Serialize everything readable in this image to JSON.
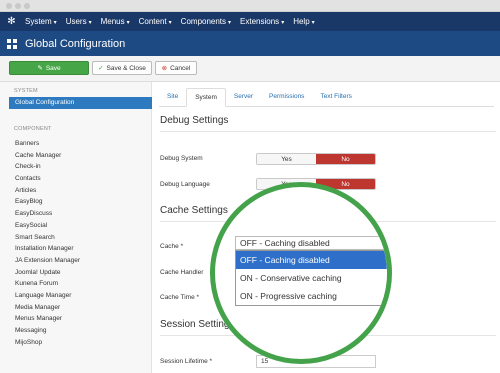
{
  "menubar": {
    "items": [
      {
        "label": "System"
      },
      {
        "label": "Users"
      },
      {
        "label": "Menus"
      },
      {
        "label": "Content"
      },
      {
        "label": "Components"
      },
      {
        "label": "Extensions"
      },
      {
        "label": "Help"
      }
    ],
    "caret": "▾"
  },
  "header": {
    "title": "Global Configuration"
  },
  "toolbar": {
    "save_label": "Save",
    "save_close_label": "Save & Close",
    "cancel_label": "Cancel"
  },
  "sidebar": {
    "system_heading": "SYSTEM",
    "active_item": "Global Configuration",
    "component_heading": "COMPONENT",
    "items": [
      "Banners",
      "Cache Manager",
      "Check-in",
      "Contacts",
      "Articles",
      "EasyBlog",
      "EasyDiscuss",
      "EasySocial",
      "Smart Search",
      "Installation Manager",
      "JA Extension Manager",
      "Joomla! Update",
      "Kunena Forum",
      "Language Manager",
      "Media Manager",
      "Menus Manager",
      "Messaging",
      "MijoShop"
    ]
  },
  "tabs": [
    "Site",
    "System",
    "Server",
    "Permissions",
    "Text Filters"
  ],
  "active_tab": "System",
  "debug": {
    "heading": "Debug Settings",
    "system_label": "Debug System",
    "language_label": "Debug Language",
    "yes": "Yes",
    "no": "No"
  },
  "cache": {
    "heading": "Cache Settings",
    "cache_label": "Cache *",
    "handler_label": "Cache Handler",
    "time_label": "Cache Time *",
    "selected": "OFF - Caching disabled",
    "options": [
      "OFF - Caching disabled",
      "ON - Conservative caching",
      "ON - Progressive caching"
    ],
    "arrow": "▴"
  },
  "session": {
    "heading": "Session Settings",
    "lifetime_label": "Session Lifetime *",
    "lifetime_value": "15"
  },
  "colors": {
    "menubar": "#1a3867",
    "titlebar": "#1e4a83",
    "save_green": "#46a546",
    "active_blue": "#2d7ac0",
    "no_red": "#bd362f",
    "highlight_circle": "#44a34a",
    "option_selected": "#2e6fc9"
  },
  "icons": {
    "brand": "joomla-logo-icon",
    "title": "grid-icon",
    "save": "pencil-square-icon",
    "save_close": "check-icon",
    "cancel": "x-circle-icon"
  }
}
